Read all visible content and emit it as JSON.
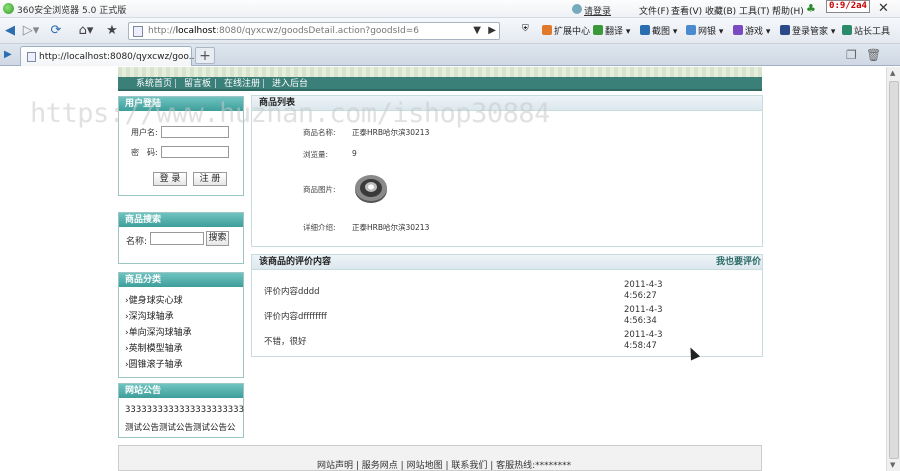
{
  "browser": {
    "title": "360安全浏览器 5.0 正式版",
    "login_link": "请登录",
    "menus": [
      "文件(F)",
      "查看(V)",
      "收藏(B)",
      "工具(T)",
      "帮助(H)"
    ],
    "counter": "0:9/2a4",
    "url_prefix": "http://",
    "url_host": "localhost",
    "url_path": ":8080/qyxcwz/goodsDetail.action?goodsId=6",
    "toolbar": [
      "扩展中心",
      "翻译",
      "截图",
      "网银",
      "游戏",
      "登录管家",
      "站长工具"
    ],
    "tab_label": "http://localhost:8080/qyxcwz/goo...",
    "new_tab": "+",
    "colors": {
      "accent": "#2a6db0",
      "nav": "#3a7f78",
      "box_header": "#4faaa6"
    }
  },
  "site": {
    "nav": [
      "系统首页",
      "留言板",
      "在线注册",
      "进入后台"
    ],
    "watermark": "https://www.huzhan.com/ishop30884",
    "login": {
      "title": "用户登陆",
      "username_label": "用户名:",
      "password_label": "密　码:",
      "login_button": "登 录",
      "register_button": "注 册"
    },
    "search": {
      "title": "商品搜索",
      "name_label": "名称:",
      "search_button": "搜索"
    },
    "categories": {
      "title": "商品分类",
      "items": [
        "健身球实心球",
        "深沟球轴承",
        "单向深沟球轴承",
        "英制模型轴承",
        "圆锥滚子轴承"
      ]
    },
    "notice": {
      "title": "网站公告",
      "lines": [
        "3333333333333333333333",
        "测试公告测试公告测试公告公"
      ]
    },
    "product": {
      "title": "商品列表",
      "name_label": "商品名称:",
      "name_value": "正泰HRB哈尔滨30213",
      "views_label": "浏览量:",
      "views_value": "9",
      "image_label": "商品图片:",
      "intro_label": "详细介绍:",
      "intro_value": "正泰HRB哈尔滨30213"
    },
    "reviews": {
      "title": "该商品的评价内容",
      "action": "我也要评价",
      "items": [
        {
          "text": "评价内容dddd",
          "date": "2011-4-3",
          "time": "4:56:27"
        },
        {
          "text": "评价内容dffffffff",
          "date": "2011-4-3",
          "time": "4:56:34"
        },
        {
          "text": "不错，很好",
          "date": "2011-4-3",
          "time": "4:58:47"
        }
      ]
    },
    "footer": {
      "links": [
        "网站声明",
        "服务网点",
        "网站地图",
        "联系我们"
      ],
      "hotline_label": "客服热线:",
      "hotline_value": "********"
    }
  }
}
